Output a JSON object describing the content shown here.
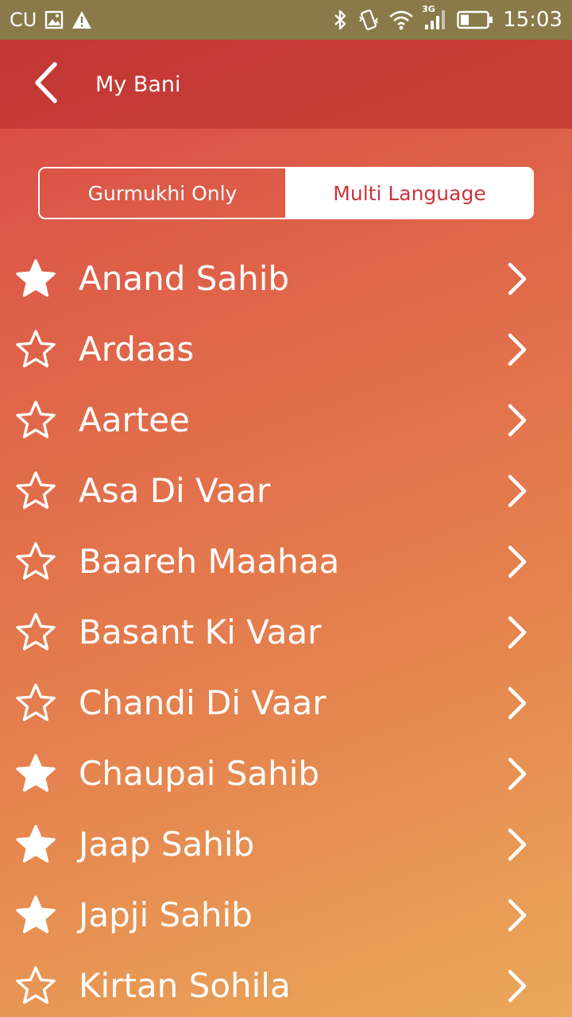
{
  "status_bar": {
    "carrier": "CU",
    "network": "3G",
    "time": "15:03",
    "icons": [
      "image-icon",
      "warning-icon",
      "bluetooth-icon",
      "vibrate-icon",
      "wifi-icon",
      "signal-icon",
      "battery-icon"
    ]
  },
  "header": {
    "title": "My Bani",
    "back_icon": "back-chevron-icon"
  },
  "segmented_control": {
    "options": [
      "Gurmukhi Only",
      "Multi Language"
    ],
    "selected": "Multi Language"
  },
  "bani_list": [
    {
      "name": "Anand Sahib",
      "favorite": true
    },
    {
      "name": "Ardaas",
      "favorite": false
    },
    {
      "name": "Aartee",
      "favorite": false
    },
    {
      "name": "Asa Di Vaar",
      "favorite": false
    },
    {
      "name": "Baareh Maahaa",
      "favorite": false
    },
    {
      "name": "Basant Ki Vaar",
      "favorite": false
    },
    {
      "name": "Chandi Di Vaar",
      "favorite": false
    },
    {
      "name": "Chaupai Sahib",
      "favorite": true
    },
    {
      "name": "Jaap Sahib",
      "favorite": true
    },
    {
      "name": "Japji Sahib",
      "favorite": true
    },
    {
      "name": "Kirtan Sohila",
      "favorite": false
    }
  ],
  "colors": {
    "gradient_top": "#d64545",
    "gradient_bottom": "#eaa85a",
    "status_bar": "#8a7a4a",
    "accent_text": "#c9353d",
    "text": "#ffffff"
  }
}
